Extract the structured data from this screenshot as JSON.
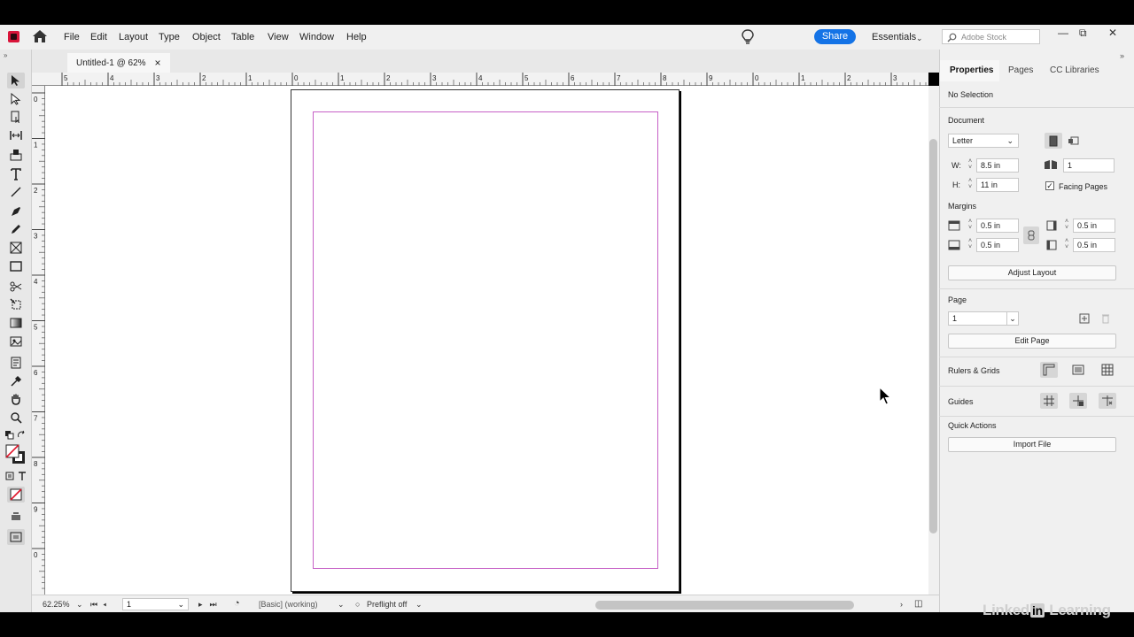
{
  "menubar": {
    "items": [
      "File",
      "Edit",
      "Layout",
      "Type",
      "Object",
      "Table",
      "View",
      "Window",
      "Help"
    ],
    "share_label": "Share",
    "workspace_label": "Essentials",
    "stock_placeholder": "Adobe Stock",
    "window_buttons": [
      "—",
      "⧉",
      "✕"
    ]
  },
  "document_tab": {
    "title": "Untitled-1 @ 62%",
    "close": "×"
  },
  "rulers": {
    "horizontal_labels": [
      "5",
      "4",
      "3",
      "2",
      "1",
      "0",
      "1",
      "2",
      "3",
      "4",
      "5",
      "6",
      "7",
      "8",
      "9",
      "0",
      "1",
      "2",
      "3",
      "4",
      "5"
    ],
    "vertical_labels": [
      "0",
      "1",
      "2",
      "3",
      "4",
      "5",
      "6",
      "7",
      "8",
      "9",
      "0"
    ]
  },
  "statusbar": {
    "zoom": "62.25%",
    "page": "1",
    "master": "[Basic] (working)",
    "preflight": "Preflight off"
  },
  "panel": {
    "tabs": [
      "Properties",
      "Pages",
      "CC Libraries"
    ],
    "selection": "No Selection",
    "document": {
      "heading": "Document",
      "preset": "Letter",
      "width_label": "W:",
      "width": "8.5 in",
      "height_label": "H:",
      "height": "11 in",
      "pages": "1",
      "facing_pages_label": "Facing Pages",
      "facing_pages_checked": true
    },
    "margins": {
      "heading": "Margins",
      "top": "0.5 in",
      "bottom": "0.5 in",
      "inside": "0.5 in",
      "outside": "0.5 in",
      "adjust_layout_label": "Adjust Layout"
    },
    "page": {
      "heading": "Page",
      "current": "1",
      "edit_page_label": "Edit Page"
    },
    "rulers_grids_label": "Rulers & Grids",
    "guides_label": "Guides",
    "quick_actions": {
      "heading": "Quick Actions",
      "import_file_label": "Import File"
    }
  },
  "watermark": {
    "pre": "Linked",
    "in": "in",
    "post": " Learning"
  },
  "colors": {
    "accent": "#1473e6",
    "margin_guide": "#c660c6",
    "app_logo": "#d9153a"
  }
}
